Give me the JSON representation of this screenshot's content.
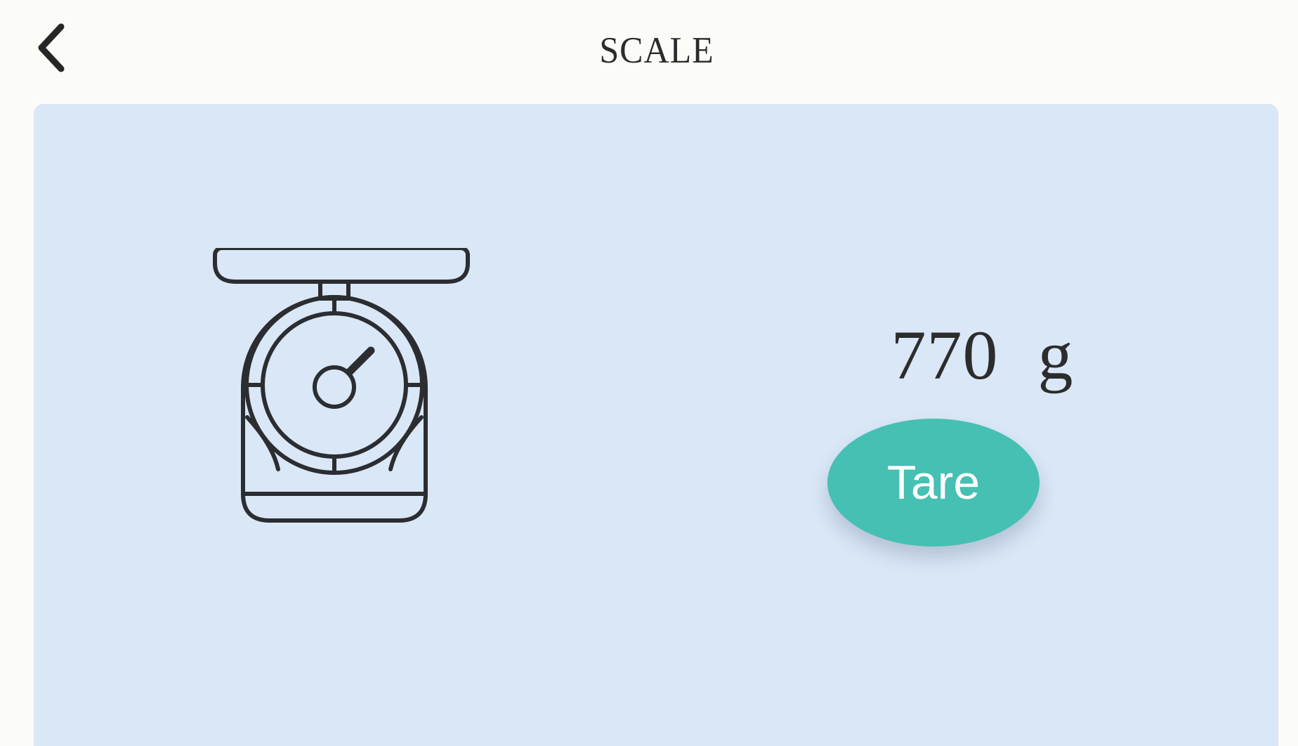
{
  "header": {
    "back_icon": "chevron-left-icon",
    "title": "SCALE"
  },
  "main": {
    "scale_icon": "kitchen-scale-icon",
    "weight": {
      "value": "770",
      "unit": "g"
    },
    "tare_label": "Tare"
  },
  "colors": {
    "background": "#fbfbf8",
    "card": "#d9e7f6",
    "accent": "#45c0b3",
    "text": "#2c2c2c"
  }
}
